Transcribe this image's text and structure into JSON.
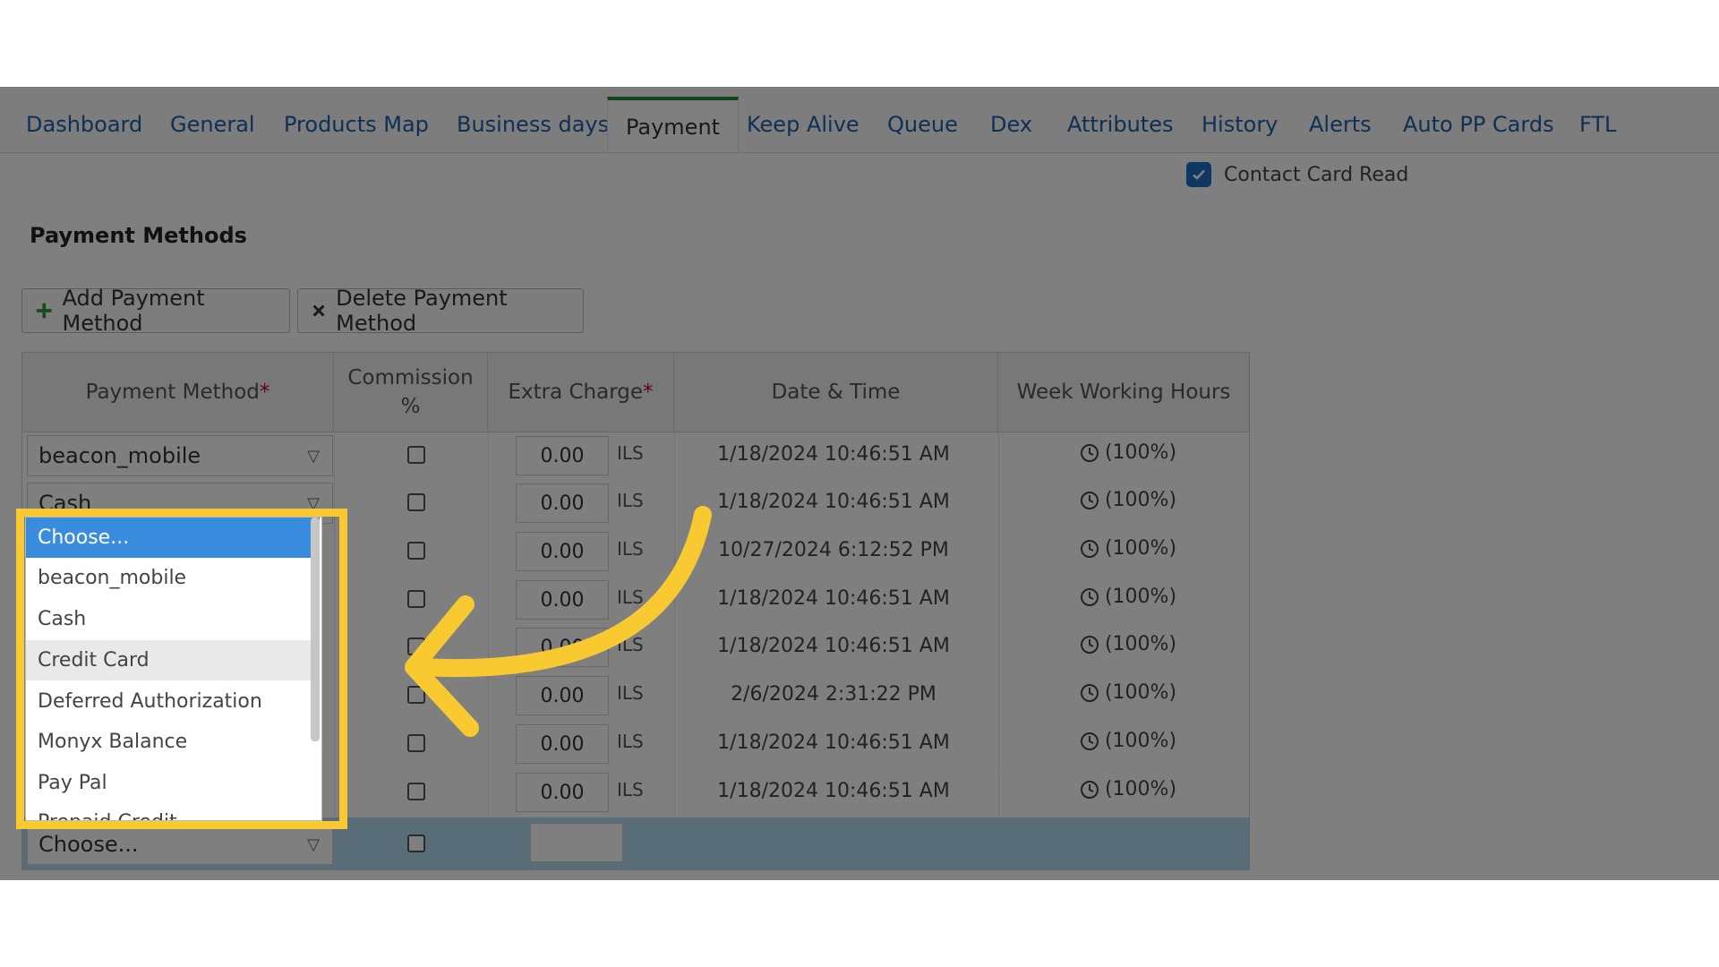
{
  "tabs": [
    {
      "label": "Dashboard",
      "active": false
    },
    {
      "label": "General",
      "active": false
    },
    {
      "label": "Products Map",
      "active": false
    },
    {
      "label": "Business days",
      "active": false
    },
    {
      "label": "Payment",
      "active": true
    },
    {
      "label": "Keep Alive",
      "active": false
    },
    {
      "label": "Queue",
      "active": false
    },
    {
      "label": "Dex",
      "active": false
    },
    {
      "label": "Attributes",
      "active": false
    },
    {
      "label": "History",
      "active": false
    },
    {
      "label": "Alerts",
      "active": false
    },
    {
      "label": "Auto PP Cards",
      "active": false
    },
    {
      "label": "FTL",
      "active": false
    }
  ],
  "contact_card_read": {
    "label": "Contact Card Read",
    "checked": true
  },
  "section_title": "Payment Methods",
  "toolbar": {
    "add_label": "Add Payment Method",
    "delete_label": "Delete Payment Method"
  },
  "grid": {
    "columns": {
      "payment_method": "Payment Method",
      "commission_line1": "Commission",
      "commission_line2": "%",
      "extra_charge": "Extra Charge",
      "date_time": "Date & Time",
      "week_working_hours": "Week Working Hours"
    },
    "required_mark": "*",
    "rows": [
      {
        "method": "beacon_mobile",
        "extra": "0.00",
        "currency": "ILS",
        "datetime": "1/18/2024 10:46:51 AM",
        "hours": "(100%)"
      },
      {
        "method": "Cash",
        "extra": "0.00",
        "currency": "ILS",
        "datetime": "1/18/2024 10:46:51 AM",
        "hours": "(100%)"
      },
      {
        "method": "",
        "extra": "0.00",
        "currency": "ILS",
        "datetime": "10/27/2024 6:12:52 PM",
        "hours": "(100%)"
      },
      {
        "method": "",
        "extra": "0.00",
        "currency": "ILS",
        "datetime": "1/18/2024 10:46:51 AM",
        "hours": "(100%)"
      },
      {
        "method": "",
        "extra": "0.00",
        "currency": "ILS",
        "datetime": "1/18/2024 10:46:51 AM",
        "hours": "(100%)"
      },
      {
        "method": "",
        "extra": "0.00",
        "currency": "ILS",
        "datetime": "2/6/2024 2:31:22 PM",
        "hours": "(100%)"
      },
      {
        "method": "",
        "extra": "0.00",
        "currency": "ILS",
        "datetime": "1/18/2024 10:46:51 AM",
        "hours": "(100%)"
      },
      {
        "method": "",
        "extra": "0.00",
        "currency": "ILS",
        "datetime": "1/18/2024 10:46:51 AM",
        "hours": "(100%)"
      }
    ],
    "new_row": {
      "method": "Choose...",
      "extra": ""
    }
  },
  "dropdown": {
    "options": [
      {
        "label": "Choose...",
        "state": "selected"
      },
      {
        "label": "beacon_mobile",
        "state": ""
      },
      {
        "label": "Cash",
        "state": ""
      },
      {
        "label": "Credit Card",
        "state": "hover"
      },
      {
        "label": "Deferred Authorization",
        "state": ""
      },
      {
        "label": "Monyx Balance",
        "state": ""
      },
      {
        "label": "Pay Pal",
        "state": ""
      },
      {
        "label": "Prepaid Credit",
        "state": ""
      }
    ]
  },
  "colors": {
    "highlight": "#f9c932",
    "tab_link": "#1e5fa8",
    "active_tab_border": "#1f8a3a",
    "selected_option": "#3a8dde",
    "checkbox_checked": "#1e6fc4"
  }
}
